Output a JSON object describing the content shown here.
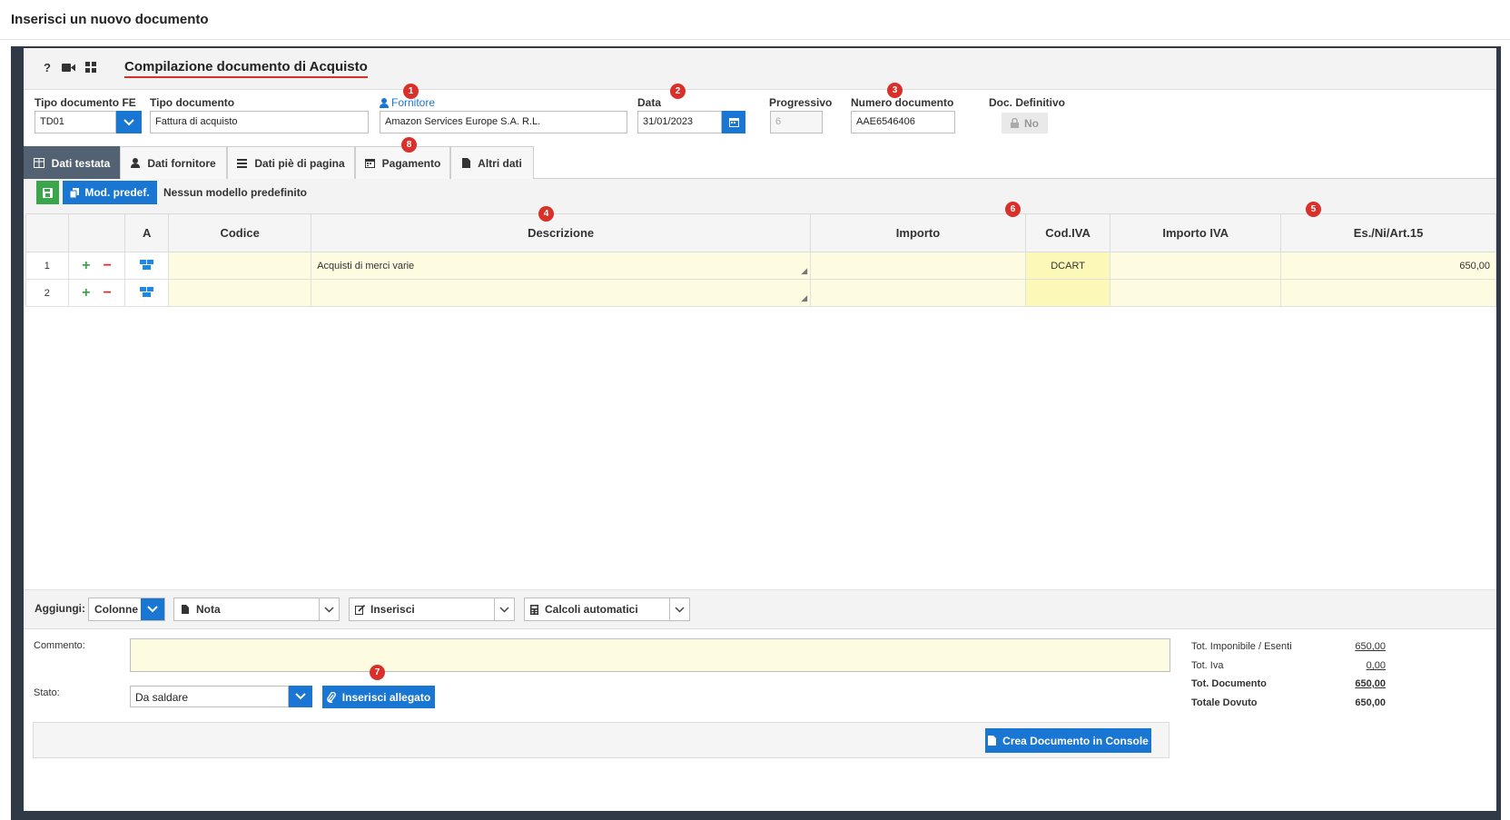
{
  "page": {
    "title": "Inserisci un nuovo documento"
  },
  "panel": {
    "title": "Compilazione documento di Acquisto",
    "icons": [
      "help-icon",
      "video-icon",
      "grid-icon"
    ],
    "help_glyph": "?"
  },
  "header": {
    "tipo_fe": {
      "label": "Tipo documento FE",
      "value": "TD01"
    },
    "tipo_doc": {
      "label": "Tipo documento",
      "value": "Fattura di acquisto"
    },
    "fornitore": {
      "label": "Fornitore",
      "value": "Amazon Services Europe S.A. R.L."
    },
    "data": {
      "label": "Data",
      "value": "31/01/2023"
    },
    "progressivo": {
      "label": "Progressivo",
      "value": "6"
    },
    "numero": {
      "label": "Numero documento",
      "value": "AAE6546406"
    },
    "definitivo": {
      "label": "Doc. Definitivo",
      "value": "No"
    }
  },
  "tabs": [
    {
      "label": "Dati testata",
      "icon": "table-icon"
    },
    {
      "label": "Dati fornitore",
      "icon": "user-icon"
    },
    {
      "label": "Dati piè di pagina",
      "icon": "list-icon"
    },
    {
      "label": "Pagamento",
      "icon": "calendar-icon"
    },
    {
      "label": "Altri dati",
      "icon": "file-icon"
    }
  ],
  "toolbar": {
    "mod_label": "Mod. predef.",
    "model_text": "Nessun modello predefinito"
  },
  "grid": {
    "columns": [
      "",
      "",
      "A",
      "Codice",
      "Descrizione",
      "Importo",
      "Cod.IVA",
      "Importo IVA",
      "Es./Ni/Art.15"
    ],
    "rows": [
      {
        "n": "1",
        "codice": "",
        "descrizione": "Acquisti di merci varie",
        "importo": "",
        "cod_iva": "DCART",
        "importo_iva": "",
        "es": "650,00"
      },
      {
        "n": "2",
        "codice": "",
        "descrizione": "",
        "importo": "",
        "cod_iva": "",
        "importo_iva": "",
        "es": ""
      }
    ],
    "add_glyph": "+",
    "remove_glyph": "−"
  },
  "addbar": {
    "label": "Aggiungi:",
    "colonne": "Colonne",
    "nota": "Nota",
    "inserisci": "Inserisci",
    "calcoli": "Calcoli automatici"
  },
  "bottom": {
    "commento_label": "Commento:",
    "commento_value": "",
    "stato_label": "Stato:",
    "stato_value": "Da saldare",
    "allegato_label": "Inserisci allegato",
    "crea_label": "Crea Documento in Console"
  },
  "totals": [
    {
      "label": "Tot. Imponibile / Esenti",
      "value": "650,00"
    },
    {
      "label": "Tot. Iva",
      "value": "0,00"
    },
    {
      "label": "Tot. Documento",
      "value": "650,00"
    },
    {
      "label": "Totale Dovuto",
      "value": "650,00"
    }
  ],
  "badges": [
    "1",
    "2",
    "3",
    "4",
    "5",
    "6",
    "7",
    "8"
  ],
  "colors": {
    "accent": "#1976d2",
    "active_tab": "#526272",
    "badge": "#d9302a",
    "save": "#3aa54a",
    "frame": "#2f3a46"
  }
}
